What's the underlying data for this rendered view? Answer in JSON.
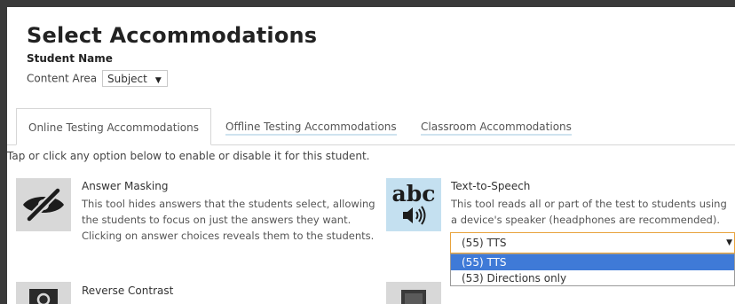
{
  "header": {
    "title": "Select Accommodations",
    "student_name": "Student Name",
    "content_area_label": "Content Area",
    "content_area_value": "Subject"
  },
  "tabs": [
    {
      "label": "Online Testing Accommodations",
      "active": true
    },
    {
      "label": "Offline Testing Accommodations",
      "active": false
    },
    {
      "label": "Classroom Accommodations",
      "active": false
    }
  ],
  "instructions": "Tap or click any option below to enable or disable it for this student.",
  "accommodations": [
    {
      "title": "Answer Masking",
      "description": "This tool hides answers that the students select, allowing the students to focus on just the answers they want. Clicking on answer choices reveals them to the students.",
      "icon": "eye-slash-icon"
    },
    {
      "title": "Text-to-Speech",
      "description": "This tool reads all or part of the test to students using a device's speaker (headphones are recommended).",
      "icon": "abc-speaker-icon",
      "icon_text": "abc",
      "select_value": "(55) TTS",
      "options": [
        "(55) TTS",
        "(53) Directions only"
      ],
      "highlighted_option": 0
    },
    {
      "title": "Reverse Contrast",
      "icon": "contrast-icon"
    },
    {
      "icon": "monitor-icon"
    }
  ],
  "colors": {
    "tab_underline": "#cfe3ef",
    "select_focus_border": "#e8a33d",
    "option_highlight": "#3f7ad7",
    "icon_gray_bg": "#d8d8d8",
    "icon_blue_bg": "#c4e0f0"
  }
}
